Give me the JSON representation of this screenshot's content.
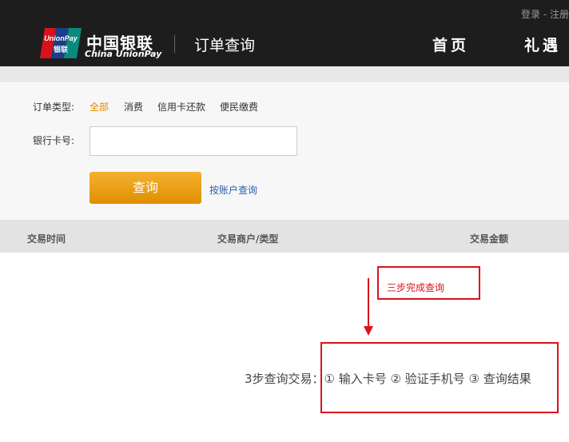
{
  "header": {
    "login": "登录",
    "separator": "-",
    "register": "注册",
    "logo_badge_top": "UnionPay",
    "logo_badge_bottom": "银联",
    "logo_cn": "中国银联",
    "logo_en": "China UnionPay",
    "section_title": "订单查询",
    "nav": [
      "首页",
      "礼遇"
    ]
  },
  "form": {
    "order_type_label": "订单类型:",
    "order_types": [
      "全部",
      "消费",
      "信用卡还款",
      "便民缴费"
    ],
    "selected_type": "全部",
    "card_label": "银行卡号:",
    "card_value": "",
    "query_button": "查询",
    "account_query_link": "按账户查询"
  },
  "table": {
    "headers": [
      "交易时间",
      "交易商户/类型",
      "交易金额"
    ]
  },
  "annotations": {
    "callout": "三步完成查询",
    "steps": "3步查询交易：① 输入卡号 ② 验证手机号 ③ 查询结果"
  },
  "colors": {
    "header_bg": "#1d1d1d",
    "accent_orange": "#e08a00",
    "link_blue": "#2a5db0",
    "annotation_red": "#d9121b"
  }
}
